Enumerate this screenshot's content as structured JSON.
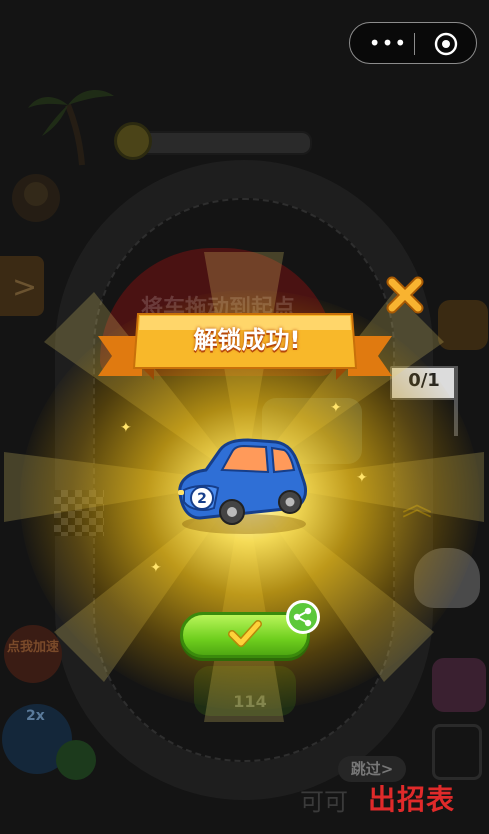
{
  "capsule": {
    "more_icon": "more-dots-icon",
    "more_glyph": "•••",
    "close_icon": "target-close-icon"
  },
  "progress": {
    "fraction": 0.12
  },
  "background": {
    "hint_text": "将车拖动到起点",
    "flag_text": "0/1",
    "speed_label": "点我加速",
    "twox_label": "2x",
    "fuel_count": "114",
    "skip_text": "跳过>"
  },
  "dialog": {
    "title": "解锁成功!",
    "close_icon": "close-x-icon",
    "car_number": "2",
    "confirm_icon": "check-icon",
    "share_icon": "share-icon"
  },
  "watermark": {
    "text": "出招表",
    "grey_text": "可可"
  },
  "colors": {
    "ribbon": "#f5a623",
    "confirm": "#7ad428",
    "car": "#2f6fd6",
    "close": "#f5a623",
    "watermark": "#e02a2a"
  }
}
